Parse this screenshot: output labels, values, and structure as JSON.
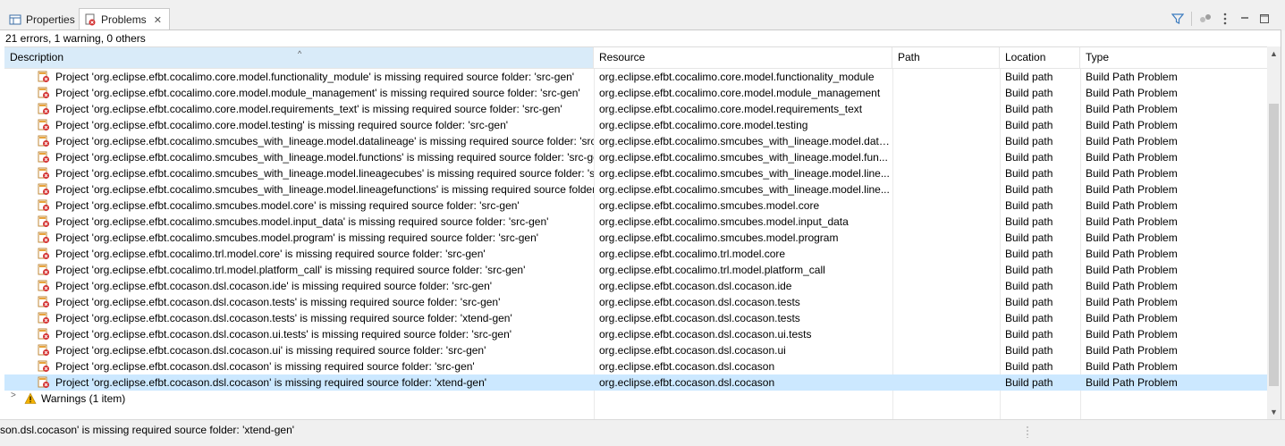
{
  "tabs": [
    {
      "label": "Properties",
      "icon": "properties-icon"
    },
    {
      "label": "Problems",
      "icon": "problems-icon",
      "close": "✕"
    }
  ],
  "toolbar": {
    "icons": [
      "filter-icon",
      "group-icon",
      "view-menu-icon",
      "minimize-icon",
      "maximize-icon"
    ]
  },
  "summary": "21 errors, 1 warning, 0 others",
  "columns": {
    "description": "Description",
    "resource": "Resource",
    "path": "Path",
    "location": "Location",
    "type": "Type"
  },
  "rows": [
    {
      "desc": "Project 'org.eclipse.efbt.cocalimo.core.model.functionality_module' is missing required source folder: 'src-gen'",
      "res": "org.eclipse.efbt.cocalimo.core.model.functionality_module",
      "path": "",
      "loc": "Build path",
      "type": "Build Path Problem"
    },
    {
      "desc": "Project 'org.eclipse.efbt.cocalimo.core.model.module_management' is missing required source folder: 'src-gen'",
      "res": "org.eclipse.efbt.cocalimo.core.model.module_management",
      "path": "",
      "loc": "Build path",
      "type": "Build Path Problem"
    },
    {
      "desc": "Project 'org.eclipse.efbt.cocalimo.core.model.requirements_text' is missing required source folder: 'src-gen'",
      "res": "org.eclipse.efbt.cocalimo.core.model.requirements_text",
      "path": "",
      "loc": "Build path",
      "type": "Build Path Problem"
    },
    {
      "desc": "Project 'org.eclipse.efbt.cocalimo.core.model.testing' is missing required source folder: 'src-gen'",
      "res": "org.eclipse.efbt.cocalimo.core.model.testing",
      "path": "",
      "loc": "Build path",
      "type": "Build Path Problem"
    },
    {
      "desc": "Project 'org.eclipse.efbt.cocalimo.smcubes_with_lineage.model.datalineage' is missing required source folder: 'src-",
      "res": "org.eclipse.efbt.cocalimo.smcubes_with_lineage.model.data...",
      "path": "",
      "loc": "Build path",
      "type": "Build Path Problem"
    },
    {
      "desc": "Project 'org.eclipse.efbt.cocalimo.smcubes_with_lineage.model.functions' is missing required source folder: 'src-ge",
      "res": "org.eclipse.efbt.cocalimo.smcubes_with_lineage.model.fun...",
      "path": "",
      "loc": "Build path",
      "type": "Build Path Problem"
    },
    {
      "desc": "Project 'org.eclipse.efbt.cocalimo.smcubes_with_lineage.model.lineagecubes' is missing required source folder: 'sr",
      "res": "org.eclipse.efbt.cocalimo.smcubes_with_lineage.model.line...",
      "path": "",
      "loc": "Build path",
      "type": "Build Path Problem"
    },
    {
      "desc": "Project 'org.eclipse.efbt.cocalimo.smcubes_with_lineage.model.lineagefunctions' is missing required source folder",
      "res": "org.eclipse.efbt.cocalimo.smcubes_with_lineage.model.line...",
      "path": "",
      "loc": "Build path",
      "type": "Build Path Problem"
    },
    {
      "desc": "Project 'org.eclipse.efbt.cocalimo.smcubes.model.core' is missing required source folder: 'src-gen'",
      "res": "org.eclipse.efbt.cocalimo.smcubes.model.core",
      "path": "",
      "loc": "Build path",
      "type": "Build Path Problem"
    },
    {
      "desc": "Project 'org.eclipse.efbt.cocalimo.smcubes.model.input_data' is missing required source folder: 'src-gen'",
      "res": "org.eclipse.efbt.cocalimo.smcubes.model.input_data",
      "path": "",
      "loc": "Build path",
      "type": "Build Path Problem"
    },
    {
      "desc": "Project 'org.eclipse.efbt.cocalimo.smcubes.model.program' is missing required source folder: 'src-gen'",
      "res": "org.eclipse.efbt.cocalimo.smcubes.model.program",
      "path": "",
      "loc": "Build path",
      "type": "Build Path Problem"
    },
    {
      "desc": "Project 'org.eclipse.efbt.cocalimo.trl.model.core' is missing required source folder: 'src-gen'",
      "res": "org.eclipse.efbt.cocalimo.trl.model.core",
      "path": "",
      "loc": "Build path",
      "type": "Build Path Problem"
    },
    {
      "desc": "Project 'org.eclipse.efbt.cocalimo.trl.model.platform_call' is missing required source folder: 'src-gen'",
      "res": "org.eclipse.efbt.cocalimo.trl.model.platform_call",
      "path": "",
      "loc": "Build path",
      "type": "Build Path Problem"
    },
    {
      "desc": "Project 'org.eclipse.efbt.cocason.dsl.cocason.ide' is missing required source folder: 'src-gen'",
      "res": "org.eclipse.efbt.cocason.dsl.cocason.ide",
      "path": "",
      "loc": "Build path",
      "type": "Build Path Problem"
    },
    {
      "desc": "Project 'org.eclipse.efbt.cocason.dsl.cocason.tests' is missing required source folder: 'src-gen'",
      "res": "org.eclipse.efbt.cocason.dsl.cocason.tests",
      "path": "",
      "loc": "Build path",
      "type": "Build Path Problem"
    },
    {
      "desc": "Project 'org.eclipse.efbt.cocason.dsl.cocason.tests' is missing required source folder: 'xtend-gen'",
      "res": "org.eclipse.efbt.cocason.dsl.cocason.tests",
      "path": "",
      "loc": "Build path",
      "type": "Build Path Problem"
    },
    {
      "desc": "Project 'org.eclipse.efbt.cocason.dsl.cocason.ui.tests' is missing required source folder: 'src-gen'",
      "res": "org.eclipse.efbt.cocason.dsl.cocason.ui.tests",
      "path": "",
      "loc": "Build path",
      "type": "Build Path Problem"
    },
    {
      "desc": "Project 'org.eclipse.efbt.cocason.dsl.cocason.ui' is missing required source folder: 'src-gen'",
      "res": "org.eclipse.efbt.cocason.dsl.cocason.ui",
      "path": "",
      "loc": "Build path",
      "type": "Build Path Problem"
    },
    {
      "desc": "Project 'org.eclipse.efbt.cocason.dsl.cocason' is missing required source folder: 'src-gen'",
      "res": "org.eclipse.efbt.cocason.dsl.cocason",
      "path": "",
      "loc": "Build path",
      "type": "Build Path Problem"
    },
    {
      "desc": "Project 'org.eclipse.efbt.cocason.dsl.cocason' is missing required source folder: 'xtend-gen'",
      "res": "org.eclipse.efbt.cocason.dsl.cocason",
      "path": "",
      "loc": "Build path",
      "type": "Build Path Problem",
      "selected": true
    }
  ],
  "warnings_group": {
    "label": "Warnings (1 item)",
    "icon": "warning-icon",
    "chevron": "chevron-right-icon"
  },
  "status": "son.dsl.cocason' is missing required source folder: 'xtend-gen'",
  "colors": {
    "selection": "#cce8ff",
    "sorted_header": "#d9ebf9",
    "error_red": "#d32f2f",
    "warning_yellow": "#f2b100"
  }
}
